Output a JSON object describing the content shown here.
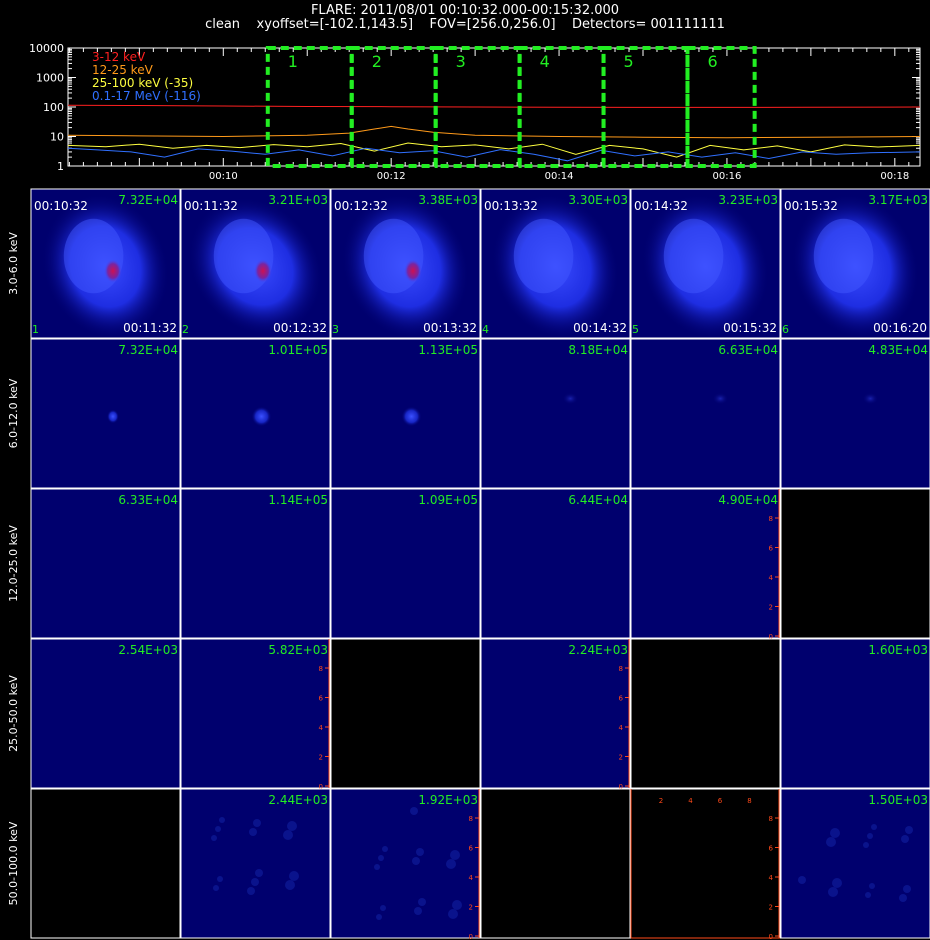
{
  "header": {
    "title": "FLARE: 2011/08/01 00:10:32.000-00:15:32.000",
    "subtitle": "clean    xyoffset=[-102.1,143.5]    FOV=[256.0,256.0]    Detectors= 001111111"
  },
  "chart_data": [
    {
      "type": "line",
      "yscale": "log",
      "ylim": [
        1,
        10000
      ],
      "y_tick_labels": [
        "1",
        "10",
        "100",
        "1000",
        "10000"
      ],
      "x_tick_labels": [
        "00:10",
        "00:12",
        "00:14",
        "00:16",
        "00:18"
      ],
      "x_tick_minutes": [
        10,
        12,
        14,
        16,
        18
      ],
      "xlim_minutes": [
        8.15,
        18.3
      ],
      "series": [
        {
          "name": "3-12 keV",
          "color": "#ff2020",
          "x": [
            8.15,
            9,
            10,
            11,
            12,
            13,
            14,
            15,
            16,
            17,
            18.3
          ],
          "y": [
            115,
            112,
            108,
            104,
            102,
            100,
            98,
            97,
            97,
            98,
            100
          ]
        },
        {
          "name": "12-25 keV",
          "color": "#ff9a1a",
          "x": [
            8.15,
            9,
            10,
            11,
            11.5,
            11.8,
            12,
            12.2,
            12.5,
            13,
            14,
            15,
            16,
            17,
            18.3
          ],
          "y": [
            11,
            10.5,
            10,
            11,
            13,
            18,
            22,
            18,
            14,
            11,
            10,
            9.5,
            9,
            9.5,
            10
          ]
        },
        {
          "name": "25-100 keV (-35)",
          "color": "#ffff40",
          "x": [
            8.15,
            8.6,
            9,
            9.4,
            9.8,
            10.2,
            10.6,
            11,
            11.4,
            11.8,
            12.2,
            12.6,
            13,
            13.4,
            13.8,
            14.2,
            14.6,
            15,
            15.4,
            15.8,
            16.2,
            16.6,
            17,
            17.4,
            17.8,
            18.3
          ],
          "y": [
            5,
            4.5,
            5.5,
            4,
            5,
            4.2,
            5.3,
            4.5,
            5.8,
            3.2,
            6,
            4.5,
            5.2,
            3.8,
            5.5,
            2.5,
            5,
            3.8,
            2,
            5,
            3.5,
            4.8,
            3,
            5.2,
            4.4,
            5
          ]
        },
        {
          "name": "0.1-17 MeV (-116)",
          "color": "#3070ff",
          "x": [
            8.15,
            8.5,
            8.9,
            9.3,
            9.7,
            10.1,
            10.5,
            10.9,
            11.3,
            11.7,
            12.1,
            12.5,
            12.9,
            13.3,
            13.7,
            14.1,
            14.5,
            14.9,
            15.3,
            15.7,
            16.1,
            16.5,
            16.9,
            17.3,
            17.7,
            18.3
          ],
          "y": [
            4,
            3.5,
            3,
            2,
            3.8,
            3.2,
            2.5,
            3.5,
            2.2,
            4,
            2.8,
            3.3,
            2,
            3.6,
            2.5,
            1.5,
            3.4,
            2.2,
            3,
            2,
            2.8,
            1.8,
            3,
            2.5,
            2.8,
            3
          ]
        }
      ],
      "time_intervals": [
        {
          "label": "1",
          "x0": 10.53,
          "x1": 11.53
        },
        {
          "label": "2",
          "x0": 11.53,
          "x1": 12.53
        },
        {
          "label": "3",
          "x0": 12.53,
          "x1": 13.53
        },
        {
          "label": "4",
          "x0": 13.53,
          "x1": 14.53
        },
        {
          "label": "5",
          "x0": 14.53,
          "x1": 15.53
        },
        {
          "label": "6",
          "x0": 15.53,
          "x1": 16.33
        }
      ],
      "interval_color": "#22ee22"
    },
    {
      "type": "heatmap",
      "row_labels": [
        "3.0-6.0 keV",
        "6.0-12.0 keV",
        "12.0-25.0 keV",
        "25.0-50.0 keV",
        "50.0-100.0 keV"
      ],
      "columns": [
        {
          "start": "00:10:32",
          "end": "00:11:32",
          "num": "1"
        },
        {
          "start": "00:11:32",
          "end": "00:12:32",
          "num": "2"
        },
        {
          "start": "00:12:32",
          "end": "00:13:32",
          "num": "3"
        },
        {
          "start": "00:13:32",
          "end": "00:14:32",
          "num": "4"
        },
        {
          "start": "00:14:32",
          "end": "00:15:32",
          "num": "5"
        },
        {
          "start": "00:15:32",
          "end": "00:16:20",
          "num": "6"
        }
      ],
      "cells": [
        [
          {
            "max": "7.32E+04",
            "image": "diffuse-core"
          },
          {
            "max": "3.21E+03",
            "image": "diffuse-core"
          },
          {
            "max": "3.38E+03",
            "image": "diffuse-core"
          },
          {
            "max": "3.30E+03",
            "image": "diffuse"
          },
          {
            "max": "3.23E+03",
            "image": "diffuse"
          },
          {
            "max": "3.17E+03",
            "image": "diffuse"
          }
        ],
        [
          {
            "max": "7.32E+04",
            "image": "source"
          },
          {
            "max": "1.01E+05",
            "image": "source"
          },
          {
            "max": "1.13E+05",
            "image": "source"
          },
          {
            "max": "8.18E+04",
            "image": "faint"
          },
          {
            "max": "6.63E+04",
            "image": "faint"
          },
          {
            "max": "4.83E+04",
            "image": "faint"
          }
        ],
        [
          {
            "max": "6.33E+04",
            "image": "flat"
          },
          {
            "max": "1.14E+05",
            "image": "flat"
          },
          {
            "max": "1.09E+05",
            "image": "flat"
          },
          {
            "max": "6.44E+04",
            "image": "flat"
          },
          {
            "max": "4.90E+04",
            "image": "flat-axis"
          },
          {
            "max": "",
            "image": "empty"
          }
        ],
        [
          {
            "max": "2.54E+03",
            "image": "flat"
          },
          {
            "max": "5.82E+03",
            "image": "flat-axis"
          },
          {
            "max": "",
            "image": "empty"
          },
          {
            "max": "2.24E+03",
            "image": "flat-axis"
          },
          {
            "max": "",
            "image": "empty"
          },
          {
            "max": "1.60E+03",
            "image": "flat"
          }
        ],
        [
          {
            "max": "",
            "image": "empty"
          },
          {
            "max": "2.44E+03",
            "image": "noise"
          },
          {
            "max": "1.92E+03",
            "image": "noise-axis"
          },
          {
            "max": "",
            "image": "empty"
          },
          {
            "max": "",
            "image": "empty-axis"
          },
          {
            "max": "1.50E+03",
            "image": "noise"
          }
        ]
      ],
      "axis_tick_labels": [
        "0",
        "2",
        "4",
        "6",
        "8"
      ],
      "axis_color": "#ff4a1a",
      "label_color": "#22ee22"
    }
  ]
}
